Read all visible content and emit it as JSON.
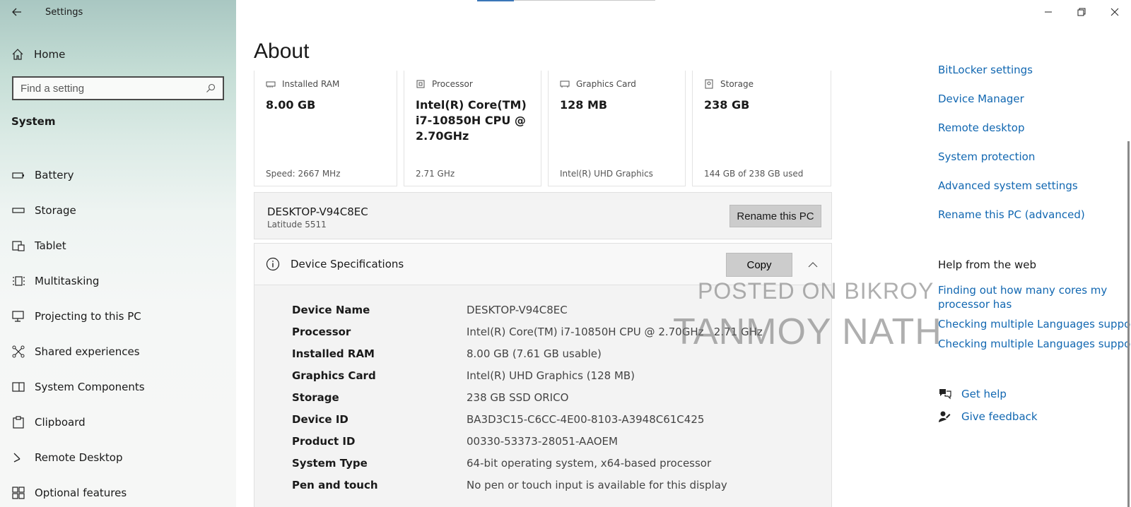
{
  "window": {
    "title": "Settings"
  },
  "sidebar": {
    "home_label": "Home",
    "search_placeholder": "Find a setting",
    "section_label": "System",
    "items": [
      {
        "label": "Battery",
        "icon": "battery-icon"
      },
      {
        "label": "Storage",
        "icon": "storage-icon"
      },
      {
        "label": "Tablet",
        "icon": "tablet-icon"
      },
      {
        "label": "Multitasking",
        "icon": "multitasking-icon"
      },
      {
        "label": "Projecting to this PC",
        "icon": "projecting-icon"
      },
      {
        "label": "Shared experiences",
        "icon": "shared-experiences-icon"
      },
      {
        "label": "System Components",
        "icon": "system-components-icon"
      },
      {
        "label": "Clipboard",
        "icon": "clipboard-icon"
      },
      {
        "label": "Remote Desktop",
        "icon": "remote-desktop-icon"
      },
      {
        "label": "Optional features",
        "icon": "optional-features-icon"
      }
    ]
  },
  "main": {
    "title": "About",
    "cards": [
      {
        "label": "Installed RAM",
        "value": "8.00 GB",
        "sub": "Speed: 2667 MHz",
        "icon": "ram-icon"
      },
      {
        "label": "Processor",
        "value": "Intel(R) Core(TM) i7-10850H CPU @ 2.70GHz",
        "sub": "2.71 GHz",
        "icon": "processor-icon"
      },
      {
        "label": "Graphics Card",
        "value": "128 MB",
        "sub": "Intel(R) UHD Graphics",
        "icon": "graphics-card-icon"
      },
      {
        "label": "Storage",
        "value": "238 GB",
        "sub": "144 GB of 238 GB used",
        "icon": "storage-drive-icon"
      }
    ],
    "pc": {
      "name": "DESKTOP-V94C8EC",
      "model": "Latitude 5511",
      "rename_label": "Rename this PC"
    },
    "specs": {
      "header": "Device Specifications",
      "copy_label": "Copy",
      "rows": [
        {
          "key": "Device Name",
          "value": "DESKTOP-V94C8EC"
        },
        {
          "key": "Processor",
          "value": "Intel(R) Core(TM) i7-10850H CPU @ 2.70GHz   2.71 GHz"
        },
        {
          "key": "Installed RAM",
          "value": "8.00 GB (7.61 GB usable)"
        },
        {
          "key": "Graphics Card",
          "value": "Intel(R) UHD Graphics (128 MB)"
        },
        {
          "key": "Storage",
          "value": "238 GB SSD ORICO"
        },
        {
          "key": "Device ID",
          "value": "BA3D3C15-C6CC-4E00-8103-A3948C61C425"
        },
        {
          "key": "Product ID",
          "value": "00330-53373-28051-AAOEM"
        },
        {
          "key": "System Type",
          "value": "64-bit operating system, x64-based processor"
        },
        {
          "key": "Pen and touch",
          "value": "No pen or touch input is available for this display"
        }
      ]
    },
    "watermark": {
      "line1": "POSTED ON BIKROY",
      "line2": "TANMOY NATH"
    }
  },
  "right_panel": {
    "links": [
      "BitLocker settings",
      "Device Manager",
      "Remote desktop",
      "System protection",
      "Advanced system settings",
      "Rename this PC (advanced)"
    ],
    "help_heading": "Help from the web",
    "help_links": [
      "Finding out how many cores my processor has",
      "Checking multiple Languages support",
      "Checking multiple Languages support"
    ],
    "get_help": "Get help",
    "give_feedback": "Give feedback"
  },
  "colors": {
    "link": "#1167b1",
    "accent": "#3a76b8"
  }
}
